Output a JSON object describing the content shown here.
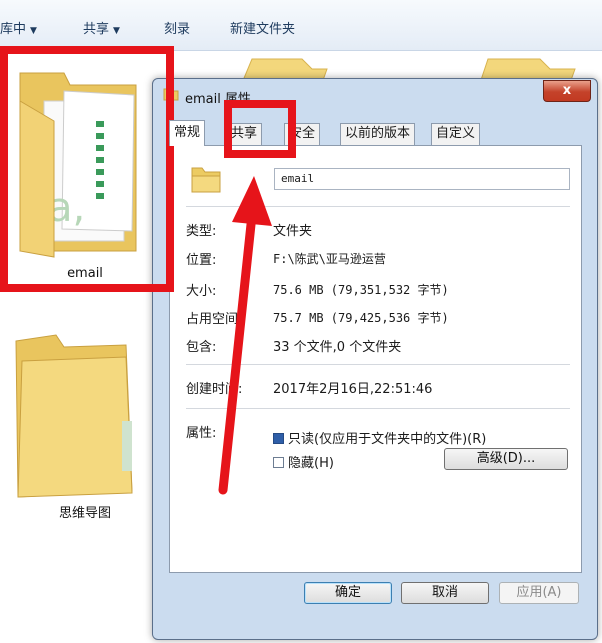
{
  "toolbar": {
    "library_label": "库中",
    "share_label": "共享",
    "burn_label": "刻录",
    "new_folder_label": "新建文件夹"
  },
  "explorer": {
    "selected_folder_name": "email",
    "second_folder_name": "思维导图"
  },
  "dialog": {
    "title": "email 属性",
    "close_label": "x",
    "tabs": [
      "常规",
      "共享",
      "安全",
      "以前的版本",
      "自定义"
    ],
    "active_tab": "常规",
    "name_value": "email",
    "props": {
      "type_label": "类型:",
      "type_value": "文件夹",
      "location_label": "位置:",
      "location_value": "F:\\陈武\\亚马逊运营",
      "size_label": "大小:",
      "size_value": "75.6 MB (79,351,532 字节)",
      "disk_label": "占用空间:",
      "disk_value": "75.7 MB (79,425,536 字节)",
      "contains_label": "包含:",
      "contains_value": "33 个文件,0 个文件夹",
      "created_label": "创建时间:",
      "created_value": "2017年2月16日,22:51:46",
      "attributes_label": "属性:",
      "readonly_label": "只读(仅应用于文件夹中的文件)(R)",
      "hidden_label": "隐藏(H)",
      "advanced_label": "高级(D)..."
    },
    "buttons": {
      "ok": "确定",
      "cancel": "取消",
      "apply": "应用(A)"
    }
  },
  "colors": {
    "annotation_red": "#e6141a",
    "dialog_frame": "#cbdcef",
    "close_button": "#c4422a"
  }
}
